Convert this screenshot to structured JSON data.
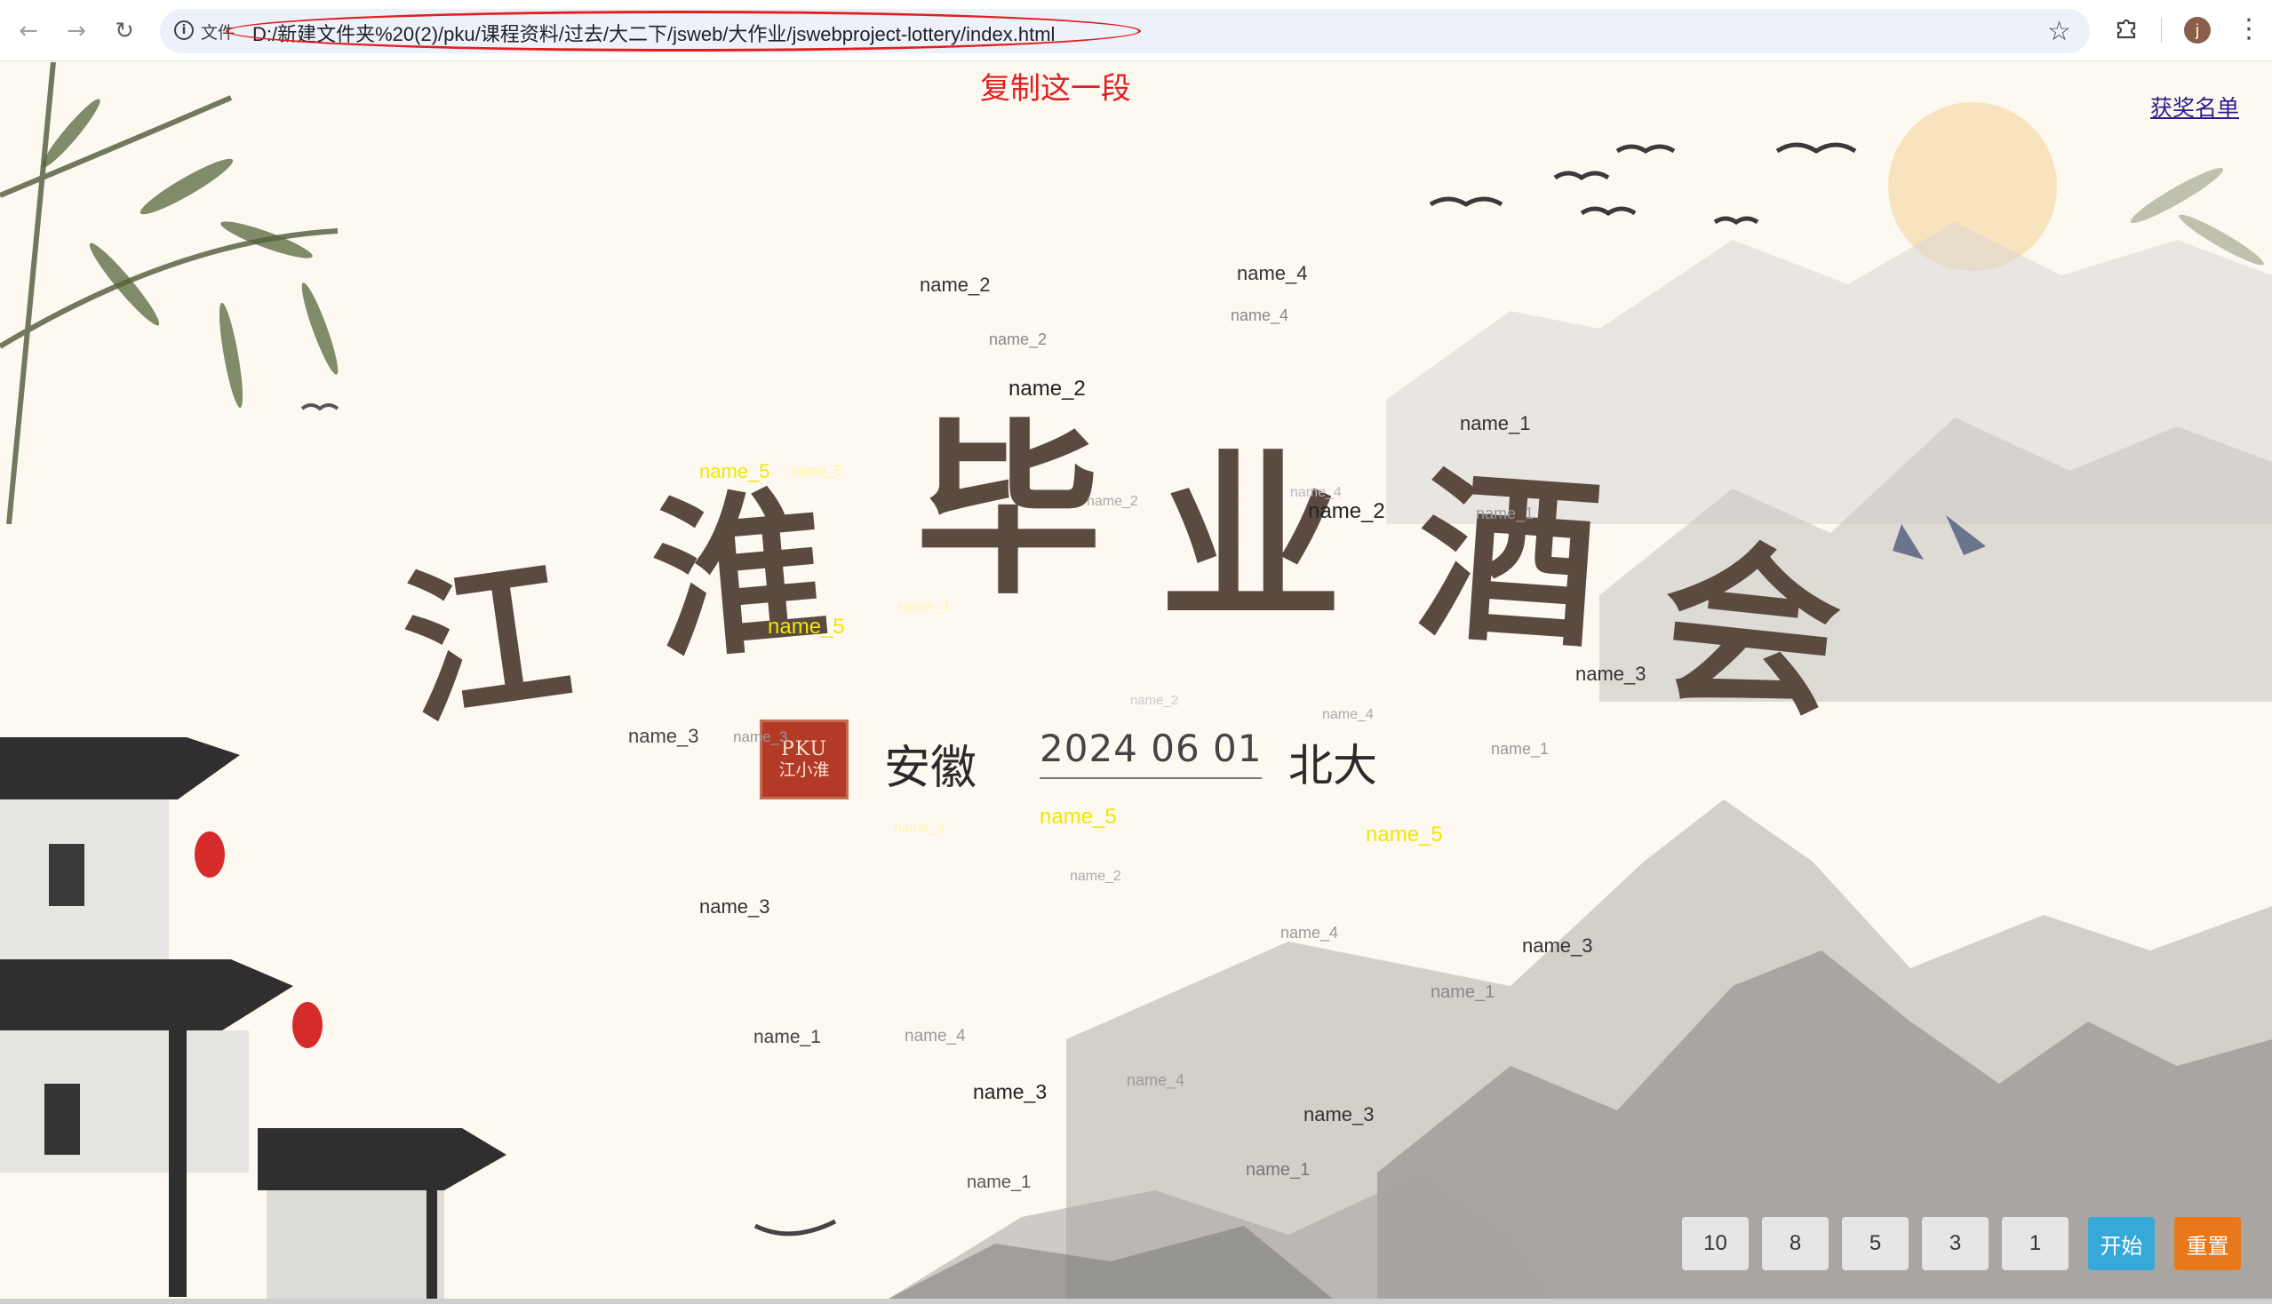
{
  "browser": {
    "back_icon": "arrow-left-icon",
    "forward_icon": "arrow-right-icon",
    "reload_icon": "reload-icon",
    "site_info_chip": "文件",
    "url": "D:/新建文件夹%20(2)/pku/课程资料/过去/大二下/jsweb/大作业/jswebproject-lottery/index.html",
    "profile_initial": "j"
  },
  "annotation": {
    "note": "复制这一段",
    "color": "#e02020"
  },
  "page": {
    "winners_link": "获奖名单",
    "title_chars": [
      "江",
      "淮",
      "毕",
      "业",
      "酒",
      "会"
    ],
    "seal_line1": "PKU",
    "seal_line2": "江小淮",
    "place": "安徽",
    "date": "2024 06 01",
    "school": "北大",
    "names": [
      {
        "text": "name_2"
      },
      {
        "text": "name_4"
      },
      {
        "text": "name_4"
      },
      {
        "text": "name_2"
      },
      {
        "text": "name_2"
      },
      {
        "text": "name_1"
      },
      {
        "text": "name_5"
      },
      {
        "text": "name_5"
      },
      {
        "text": "name_2"
      },
      {
        "text": "name_4"
      },
      {
        "text": "name_2"
      },
      {
        "text": "name_5"
      },
      {
        "text": "name_4"
      },
      {
        "text": "name_3"
      },
      {
        "text": "name_2"
      },
      {
        "text": "name_4"
      },
      {
        "text": "name_3"
      },
      {
        "text": "name_1"
      },
      {
        "text": "name_1"
      },
      {
        "text": "name_5"
      },
      {
        "text": "name_5"
      },
      {
        "text": "name_4"
      },
      {
        "text": "name_2"
      },
      {
        "text": "name_3"
      },
      {
        "text": "name_4"
      },
      {
        "text": "name_3"
      },
      {
        "text": "name_1"
      },
      {
        "text": "name_1"
      },
      {
        "text": "name_4"
      },
      {
        "text": "name_3"
      },
      {
        "text": "name_4"
      },
      {
        "text": "name_3"
      },
      {
        "text": "name_1"
      },
      {
        "text": "name_1"
      },
      {
        "text": "name_3"
      }
    ],
    "controls": {
      "counts": [
        "10",
        "8",
        "5",
        "3",
        "1"
      ],
      "start": "开始",
      "reset": "重置"
    }
  },
  "colors": {
    "title": "#5a4a40",
    "highlight_name": "#ffff00",
    "start_button": "#36a9d9",
    "reset_button": "#e8781c"
  }
}
